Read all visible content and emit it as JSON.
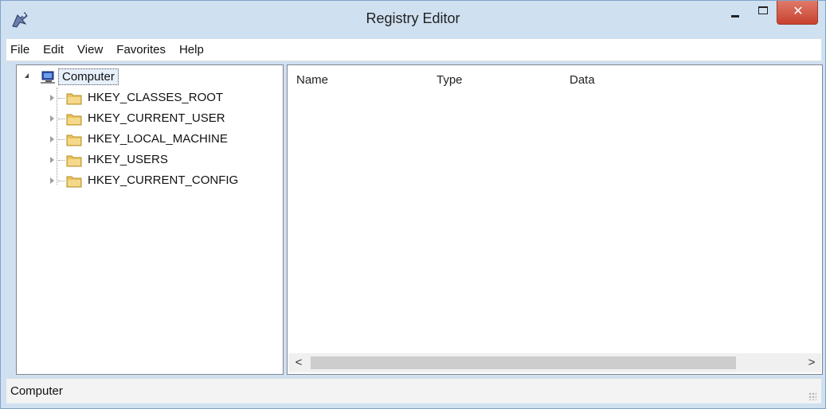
{
  "window": {
    "title": "Registry Editor"
  },
  "menu": [
    "File",
    "Edit",
    "View",
    "Favorites",
    "Help"
  ],
  "tree": {
    "root": "Computer",
    "items": [
      "HKEY_CLASSES_ROOT",
      "HKEY_CURRENT_USER",
      "HKEY_LOCAL_MACHINE",
      "HKEY_USERS",
      "HKEY_CURRENT_CONFIG"
    ]
  },
  "list": {
    "columns": [
      "Name",
      "Type",
      "Data"
    ]
  },
  "scroll": {
    "left_arrow": "<",
    "right_arrow": ">"
  },
  "status": {
    "text": "Computer"
  },
  "colors": {
    "title_bg": "#cfe0f1",
    "close_button": "#c7412e",
    "folder": "#e8c25a"
  }
}
